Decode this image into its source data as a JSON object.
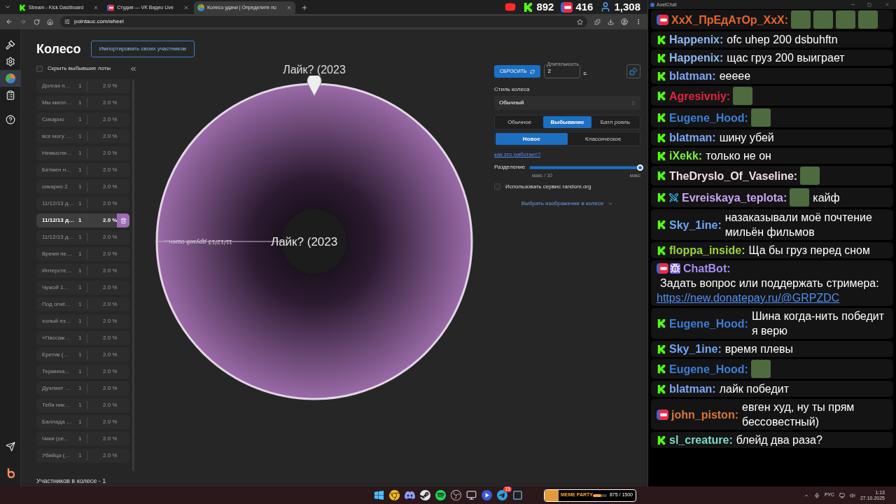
{
  "browser": {
    "tabs": [
      {
        "kind": "kick",
        "title": "Stream - Kick Dashboard",
        "selected": false
      },
      {
        "kind": "vk",
        "title": "Студия — VK Видео Live",
        "selected": false
      },
      {
        "kind": "wheel",
        "title": "Колесо удачи | Определите по",
        "selected": true
      }
    ],
    "stats": [
      {
        "kind": "youtube"
      },
      {
        "kind": "kick",
        "value": "892"
      },
      {
        "kind": "vk",
        "value": "416"
      },
      {
        "kind": "viewers",
        "value": "1,308"
      }
    ],
    "url": "pointauc.com/wheel"
  },
  "rail": {
    "items": [
      {
        "kind": "gavel",
        "selected": false
      },
      {
        "kind": "settings",
        "selected": false
      },
      {
        "kind": "wheel",
        "selected": true
      },
      {
        "kind": "clipboard",
        "selected": false
      },
      {
        "kind": "help",
        "selected": false
      }
    ],
    "bottom": [
      {
        "kind": "send"
      },
      {
        "kind": "logo"
      }
    ]
  },
  "page": {
    "title": "Колесо",
    "import_button": "Импортировать своих участников",
    "hide_eliminated": {
      "label": "Скрыть выбывшие лоты",
      "checked": false
    },
    "lots": [
      {
        "name": "Долгая п…",
        "amount": "1",
        "share": "2.0 %",
        "eliminated": true
      },
      {
        "name": "Мы милл…",
        "amount": "1",
        "share": "2.0 %",
        "eliminated": true
      },
      {
        "name": "Сикарио",
        "amount": "1",
        "share": "2.0 %",
        "eliminated": true
      },
      {
        "name": "все могу …",
        "amount": "1",
        "share": "2.0 %",
        "eliminated": true
      },
      {
        "name": "Немысли…",
        "amount": "1",
        "share": "2.0 %",
        "eliminated": true
      },
      {
        "name": "Бетмен н…",
        "amount": "1",
        "share": "2.0 %",
        "eliminated": true
      },
      {
        "name": "сикарио 2",
        "amount": "1",
        "share": "2.0 %",
        "eliminated": true
      },
      {
        "name": "11/12/13 д…",
        "amount": "1",
        "share": "2.0 %",
        "eliminated": true
      },
      {
        "name": "11/12/13 д…",
        "amount": "1",
        "share": "2.0 %",
        "eliminated": false
      },
      {
        "name": "11/12/13 д…",
        "amount": "1",
        "share": "2.0 %",
        "eliminated": true
      },
      {
        "name": "Время пе…",
        "amount": "1",
        "share": "2.0 %",
        "eliminated": true
      },
      {
        "name": "Интерсте…",
        "amount": "1",
        "share": "2.0 %",
        "eliminated": true
      },
      {
        "name": "Чужой 1…",
        "amount": "1",
        "share": "2.0 %",
        "eliminated": true
      },
      {
        "name": "Под огнё…",
        "amount": "1",
        "share": "2.0 %",
        "eliminated": true
      },
      {
        "name": "холый пэ…",
        "amount": "1",
        "share": "2.0 %",
        "eliminated": true
      },
      {
        "name": "«Пассаж…",
        "amount": "1",
        "share": "2.0 %",
        "eliminated": true
      },
      {
        "name": "Еретик (…",
        "amount": "1",
        "share": "2.0 %",
        "eliminated": true
      },
      {
        "name": "Термина…",
        "amount": "1",
        "share": "2.0 %",
        "eliminated": true
      },
      {
        "name": "Дуэлянт …",
        "amount": "1",
        "share": "2.0 %",
        "eliminated": true
      },
      {
        "name": "Тебя ник…",
        "amount": "1",
        "share": "2.0 %",
        "eliminated": true
      },
      {
        "name": "Баллада …",
        "amount": "1",
        "share": "2.0 %",
        "eliminated": true
      },
      {
        "name": "Чики (се…",
        "amount": "1",
        "share": "2.0 %",
        "eliminated": true
      },
      {
        "name": "Убийца (…",
        "amount": "1",
        "share": "2.0 %",
        "eliminated": true
      }
    ],
    "participants": "Участников в колесе - 1"
  },
  "wheel": {
    "pointer_label": "Лайк? (2023",
    "center_label": "Лайк? (2023",
    "segment_label": "11/12/13 друзей ошен..."
  },
  "controls": {
    "reset_button": "СБРОСИТЬ",
    "duration": {
      "label": "Длительность",
      "value": "2",
      "unit": "с."
    },
    "style": {
      "label": "Стиль колеса",
      "value": "Обычный"
    },
    "modes": [
      {
        "label": "Обычное",
        "selected": false
      },
      {
        "label": "Выбывание",
        "selected": true
      },
      {
        "label": "Батл рояль",
        "selected": false
      }
    ],
    "variants": [
      {
        "label": "Новое",
        "selected": true
      },
      {
        "label": "Классическое",
        "selected": false
      }
    ],
    "help_link": "как это работает?",
    "split": {
      "label": "Разделение",
      "level": 1,
      "min_label": "макс / 10",
      "max_label": "макс"
    },
    "random_org": {
      "label": "Использовать сервис random.org",
      "checked": false
    },
    "image_picker": "Выбрать изображение в колесе"
  },
  "chat": {
    "title": "AxelChat",
    "messages": [
      {
        "kind": "vk",
        "user": "XxX_ПрЕдАтОр_XxX:",
        "color": "#e8642a",
        "parts": [
          {
            "kind": "emote"
          },
          {
            "kind": "emote"
          },
          {
            "kind": "emote"
          },
          {
            "kind": "emote"
          }
        ]
      },
      {
        "kind": "kick",
        "user": "Happenix:",
        "color": "#8fb8f0",
        "parts": [
          {
            "kind": "text",
            "text": "ofc uhep 200 dsbuhftn"
          }
        ]
      },
      {
        "kind": "kick",
        "user": "Happenix:",
        "color": "#8fb8f0",
        "parts": [
          {
            "kind": "text",
            "text": "щас груз 200 выиграет"
          }
        ]
      },
      {
        "kind": "kick",
        "user": "blatman:",
        "color": "#7ea6f5",
        "parts": [
          {
            "kind": "text",
            "text": "eeeee"
          }
        ]
      },
      {
        "kind": "kick",
        "user": "Agresivniy:",
        "color": "#e0263f",
        "parts": [
          {
            "kind": "emote"
          }
        ]
      },
      {
        "kind": "kick",
        "user": "Eugene_Hood:",
        "color": "#3b7fd8",
        "parts": [
          {
            "kind": "emote"
          }
        ]
      },
      {
        "kind": "kick",
        "user": "blatman:",
        "color": "#7ea6f5",
        "parts": [
          {
            "kind": "text",
            "text": "шину убей"
          }
        ]
      },
      {
        "kind": "kick",
        "user": "iXekk:",
        "color": "#7cf03a",
        "parts": [
          {
            "kind": "text",
            "text": "только не он"
          }
        ]
      },
      {
        "kind": "kick",
        "user": "TheDryslo_Of_Vaseline:",
        "color": "#f2dde6",
        "parts": [
          {
            "kind": "emote"
          }
        ]
      },
      {
        "kind": "kick",
        "badges": [
          {
            "kind": "sword"
          }
        ],
        "user": "Evreiskaya_teplota:",
        "color": "#c9a4f2",
        "parts": [
          {
            "kind": "emote"
          },
          {
            "kind": "text",
            "text": "кайф"
          }
        ]
      },
      {
        "kind": "kick",
        "user": "Sky_1ine:",
        "color": "#6fa6f2",
        "parts": [
          {
            "kind": "text",
            "text": "назаказывали моё почтение мильён фильмов"
          }
        ]
      },
      {
        "kind": "kick",
        "user": "floppa_inside:",
        "color": "#9ad43c",
        "parts": [
          {
            "kind": "text",
            "text": "Ща бы груз перед сном"
          }
        ]
      },
      {
        "kind": "vk",
        "badges": [
          {
            "kind": "invader"
          }
        ],
        "user": "ChatBot:",
        "color": "#a58cf2",
        "parts": [
          {
            "kind": "break"
          },
          {
            "kind": "text",
            "text": "Задать вопрос или поддержать стримера:"
          },
          {
            "kind": "link",
            "text": "https://new.donatepay.ru/@GRPZDC"
          }
        ]
      },
      {
        "kind": "kick",
        "user": "Eugene_Hood:",
        "color": "#3b7fd8",
        "parts": [
          {
            "kind": "text",
            "text": "Шина когда-нить победит я верю"
          }
        ]
      },
      {
        "kind": "kick",
        "user": "Sky_1ine:",
        "color": "#6fa6f2",
        "parts": [
          {
            "kind": "text",
            "text": "время плевы"
          }
        ]
      },
      {
        "kind": "kick",
        "user": "Eugene_Hood:",
        "color": "#3b7fd8",
        "parts": [
          {
            "kind": "emote"
          }
        ]
      },
      {
        "kind": "kick",
        "user": "blatman:",
        "color": "#7ea6f5",
        "parts": [
          {
            "kind": "text",
            "text": "лайк победит"
          }
        ]
      },
      {
        "kind": "vk",
        "user": "john_piston:",
        "color": "#d8773a",
        "parts": [
          {
            "kind": "text",
            "text": "евген худ, ну ты прям бессовестный)"
          }
        ]
      },
      {
        "kind": "kick",
        "user": "sl_creature:",
        "color": "#7fd9c6",
        "parts": [
          {
            "kind": "text",
            "text": "блейд два раза?"
          }
        ]
      }
    ]
  },
  "taskbar": {
    "apps": [
      {
        "kind": "windows"
      },
      {
        "kind": "chrome"
      },
      {
        "kind": "discord"
      },
      {
        "kind": "steam"
      },
      {
        "kind": "spotify"
      },
      {
        "kind": "obs"
      },
      {
        "kind": "screen"
      },
      {
        "kind": "play"
      },
      {
        "kind": "telegram",
        "badge": "15"
      },
      {
        "kind": "share"
      }
    ],
    "widget": {
      "title": "MEME PARTY",
      "progress": "875 / 1500",
      "level": 0.58
    },
    "language": "РУС",
    "time": "1:13",
    "date": "27.10.2025"
  }
}
